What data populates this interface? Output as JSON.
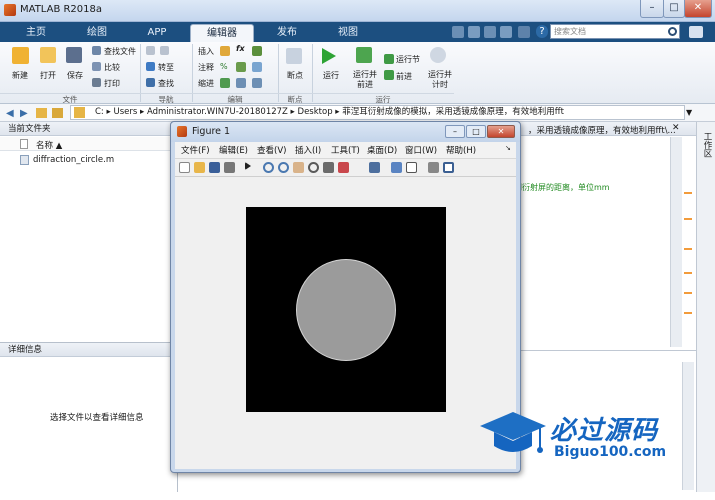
{
  "app": {
    "title": "MATLAB R2018a"
  },
  "tabs": {
    "home": "主页",
    "plots": "绘图",
    "apps": "APP",
    "editor": "编辑器",
    "publish": "发布",
    "view": "视图"
  },
  "search": {
    "placeholder": "搜索文档"
  },
  "ribbon": {
    "new": "新建",
    "open": "打开",
    "save": "保存",
    "find_files": "查找文件",
    "compare": "比较",
    "print": "打印",
    "goto": "转至",
    "find": "查找",
    "insert": "插入",
    "comment": "注释",
    "indent": "缩进",
    "fx": "fx",
    "breakpoints": "断点",
    "run": "运行",
    "run_advance": "运行并\n前进",
    "run_section": "运行节",
    "advance": "前进",
    "run_time": "运行并\n计时",
    "groups": {
      "file": "文件",
      "navigate": "导航",
      "edit": "编辑",
      "breakpoints": "断点",
      "run": "运行"
    }
  },
  "address": {
    "path": "C:  ▸  Users  ▸  Administrator.WIN7U-20180127Z  ▸  Desktop  ▸  菲涅耳衍射成像的模拟，采用透镜成像原理，有效地利用fft"
  },
  "current_folder": {
    "title": "当前文件夹",
    "column_name": "名称 ▲",
    "files": [
      "diffraction_circle.m"
    ]
  },
  "details": {
    "title": "详细信息",
    "message": "选择文件以查看详细信息"
  },
  "editor": {
    "tab_text": "，采用透镜成像原理，有效地利用fft\\...",
    "code_comment": "到衍射屏的距离，单位mm"
  },
  "right_strip": {
    "label": "工作区"
  },
  "figure": {
    "title": "Figure 1",
    "menu": [
      "文件(F)",
      "编辑(E)",
      "查看(V)",
      "插入(I)",
      "工具(T)",
      "桌面(D)",
      "窗口(W)",
      "帮助(H)"
    ]
  },
  "watermark": {
    "brand": "必过源码",
    "url": "Biguo100.com"
  },
  "colors": {
    "tabbar": "#1c4f80",
    "active_tab": "#f3f6fa",
    "run_green": "#2da334",
    "watermark_blue": "#1565c0"
  }
}
